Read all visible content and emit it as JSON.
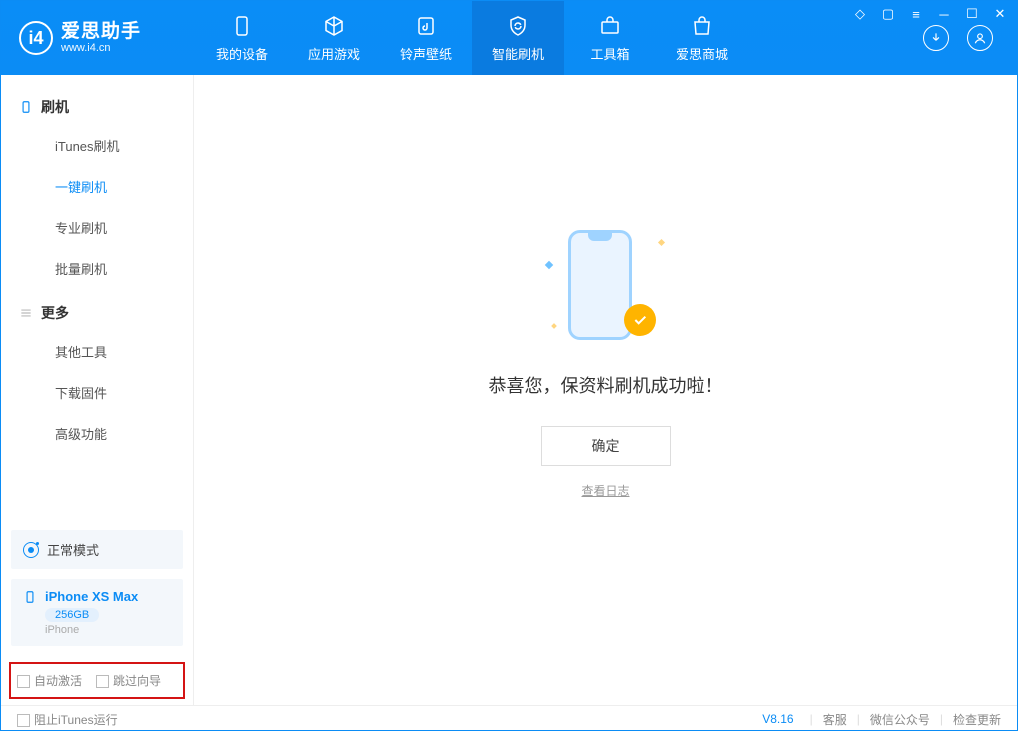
{
  "app": {
    "title": "爱思助手",
    "subtitle": "www.i4.cn"
  },
  "tabs": {
    "device": "我的设备",
    "apps": "应用游戏",
    "ring": "铃声壁纸",
    "flash": "智能刷机",
    "tools": "工具箱",
    "store": "爱思商城"
  },
  "sidebar": {
    "section1": "刷机",
    "items1": {
      "itunes": "iTunes刷机",
      "oneclick": "一键刷机",
      "pro": "专业刷机",
      "batch": "批量刷机"
    },
    "section2": "更多",
    "items2": {
      "other": "其他工具",
      "firmware": "下载固件",
      "advanced": "高级功能"
    }
  },
  "mode": {
    "label": "正常模式"
  },
  "device": {
    "name": "iPhone XS Max",
    "storage": "256GB",
    "type": "iPhone"
  },
  "highlight": {
    "auto_activate": "自动激活",
    "skip_guide": "跳过向导"
  },
  "main": {
    "message": "恭喜您，保资料刷机成功啦！",
    "ok": "确定",
    "log": "查看日志"
  },
  "footer": {
    "block_itunes": "阻止iTunes运行",
    "version": "V8.16",
    "service": "客服",
    "wechat": "微信公众号",
    "update": "检查更新"
  }
}
